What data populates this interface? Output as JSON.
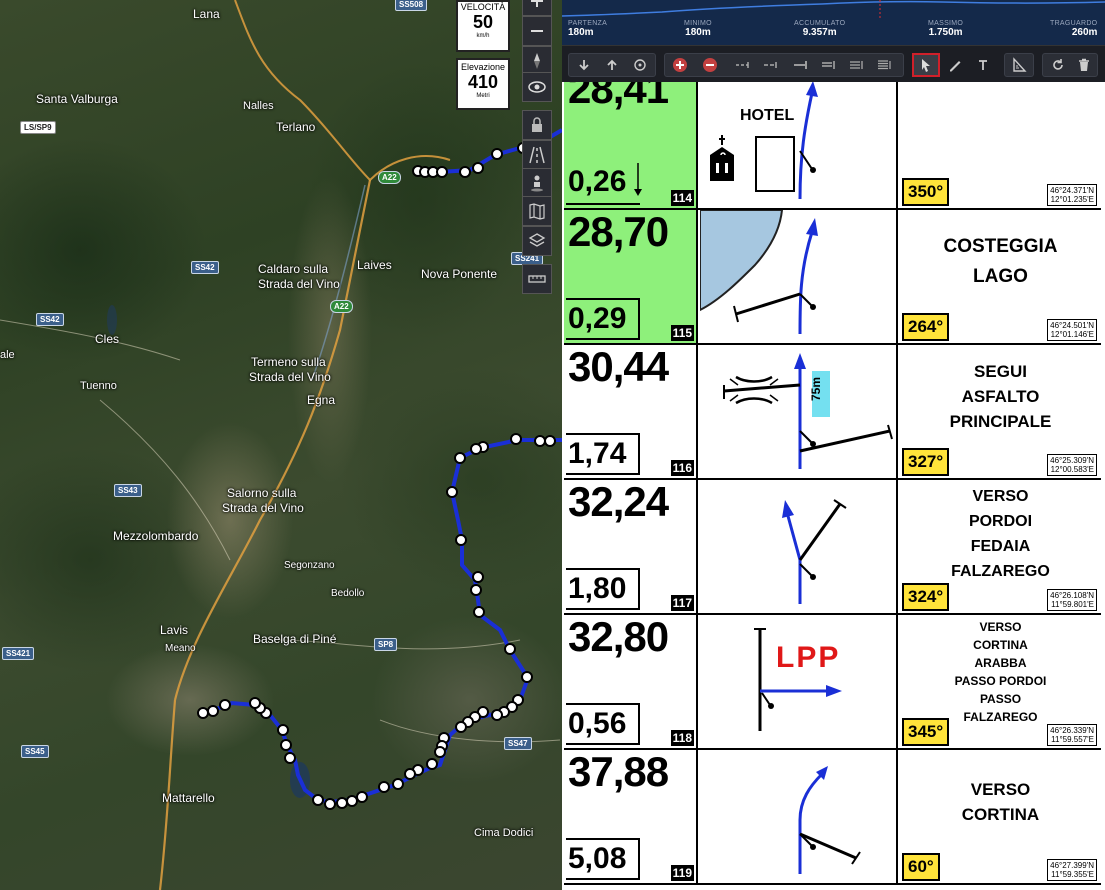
{
  "map": {
    "labels": {
      "lana": "Lana",
      "santa_valburga": "Santa Valburga",
      "nalles": "Nalles",
      "terlano": "Terlano",
      "caldaro": "Caldaro sulla\nStrada del Vino",
      "caldaro_l1": "Caldaro sulla",
      "caldaro_l2": "Strada del Vino",
      "laives": "Laives",
      "nova_ponente": "Nova Ponente",
      "cles": "Cles",
      "termeno_l1": "Termeno sulla",
      "termeno_l2": "Strada del Vino",
      "tuenno": "Tuenno",
      "egna": "Egna",
      "ale": "ale",
      "salorno_l1": "Salorno sulla",
      "salorno_l2": "Strada del Vino",
      "mezzolombardo": "Mezzolombardo",
      "segonzano": "Segonzano",
      "bedollo": "Bedollo",
      "lavis": "Lavis",
      "meano": "Meano",
      "baselga": "Baselga di Piné",
      "mattarello": "Mattarello",
      "cima_dodici": "Cima Dodici"
    },
    "shields": {
      "ss508": "SS508",
      "ls_sp9": "LS/SP9",
      "a22_top": "A22",
      "ss42_a": "SS42",
      "ss241": "SS241",
      "a22_mid": "A22",
      "ss42_b": "SS42",
      "ss43": "SS43",
      "sp8": "SP8",
      "ss421": "SS421",
      "ss47": "SS47",
      "ss45": "SS45"
    }
  },
  "speed_box": {
    "label": "VELOCITÀ",
    "value": "50",
    "unit": "km/h"
  },
  "elev_box": {
    "label": "Elevazione",
    "value": "410",
    "unit": "Metri"
  },
  "map_controls": [
    "plus-icon",
    "minus-icon",
    "compass-icon",
    "eye-icon",
    "lock-icon",
    "road-icon",
    "pegman-icon",
    "map-icon",
    "layers-icon",
    "ruler-icon"
  ],
  "profile_stats": [
    {
      "key": "PARTENZA",
      "value": "180m"
    },
    {
      "key": "MINIMO",
      "value": "180m"
    },
    {
      "key": "ACCUMULATO",
      "value": "9.357m"
    },
    {
      "key": "MASSIMO",
      "value": "1.750m"
    },
    {
      "key": "TRAGUARDO",
      "value": "260m"
    }
  ],
  "rows": [
    {
      "total": "28,41",
      "partial": "0,26",
      "num": "114",
      "heading": "350°",
      "coord_lat": "46°24.371'N",
      "coord_lon": "12°01.235'E",
      "note": [],
      "green": true,
      "icon_text": "HOTEL"
    },
    {
      "total": "28,70",
      "partial": "0,29",
      "num": "115",
      "heading": "264°",
      "coord_lat": "46°24.501'N",
      "coord_lon": "12°01.146'E",
      "note": [
        "COSTEGGIA",
        "LAGO"
      ],
      "green": true
    },
    {
      "total": "30,44",
      "partial": "1,74",
      "num": "116",
      "heading": "327°",
      "coord_lat": "46°25.309'N",
      "coord_lon": "12°00.583'E",
      "note": [
        "SEGUI",
        "ASFALTO",
        "PRINCIPALE"
      ],
      "green": false,
      "icon_text": "75m"
    },
    {
      "total": "32,24",
      "partial": "1,80",
      "num": "117",
      "heading": "324°",
      "coord_lat": "46°26.108'N",
      "coord_lon": "11°59.801'E",
      "note": [
        "VERSO",
        "PORDOI",
        "FEDAIA",
        "FALZAREGO"
      ],
      "green": false
    },
    {
      "total": "32,80",
      "partial": "0,56",
      "num": "118",
      "heading": "345°",
      "coord_lat": "46°26.339'N",
      "coord_lon": "11°59.557'E",
      "note": [
        "VERSO",
        "CORTINA",
        "ARABBA",
        "PASSO PORDOI",
        "PASSO",
        "FALZAREGO"
      ],
      "green": false,
      "icon_text": "LPP"
    },
    {
      "total": "37,88",
      "partial": "5,08",
      "num": "119",
      "heading": "60°",
      "coord_lat": "46°27.399'N",
      "coord_lon": "11°59.355'E",
      "note": [
        "VERSO",
        "CORTINA"
      ],
      "green": false
    }
  ],
  "colors": {
    "route": "#1a2fd6",
    "green_cell": "#8ef07b",
    "heading_bg": "#ffe33a",
    "arrow": "#0a1fe0"
  }
}
